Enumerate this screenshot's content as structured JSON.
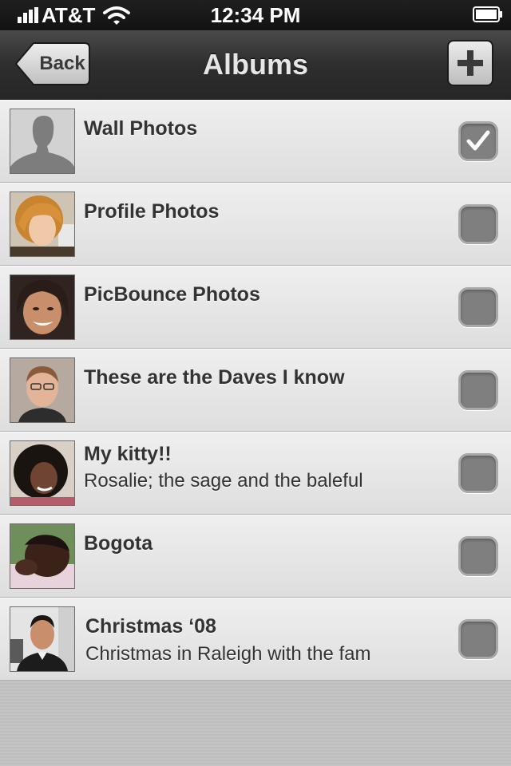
{
  "status_bar": {
    "carrier": "AT&T",
    "time": "12:34 PM",
    "icons": [
      "signal-icon",
      "wifi-icon",
      "battery-icon"
    ]
  },
  "nav_bar": {
    "back_label": "Back",
    "title": "Albums",
    "add_icon": "plus-icon"
  },
  "albums": [
    {
      "title": "Wall Photos",
      "subtitle": "",
      "checked": true,
      "thumb": "silhouette"
    },
    {
      "title": "Profile Photos",
      "subtitle": "",
      "checked": false,
      "thumb": "photo"
    },
    {
      "title": "PicBounce Photos",
      "subtitle": "",
      "checked": false,
      "thumb": "photo"
    },
    {
      "title": "These are the Daves I know",
      "subtitle": "",
      "checked": false,
      "thumb": "photo"
    },
    {
      "title": "My kitty!!",
      "subtitle": "Rosalie; the sage and the baleful",
      "checked": false,
      "thumb": "photo"
    },
    {
      "title": "Bogota",
      "subtitle": "",
      "checked": false,
      "thumb": "photo"
    },
    {
      "title": "Christmas ‘08",
      "subtitle": "Christmas in Raleigh with the fam",
      "checked": false,
      "thumb": "photo"
    }
  ],
  "colors": {
    "status_bar": "#121212",
    "nav_bar": "#2e2e2e",
    "row_background": "#e6e6e6",
    "checkbox_fill": "#7f7f7f",
    "text": "#333333"
  }
}
